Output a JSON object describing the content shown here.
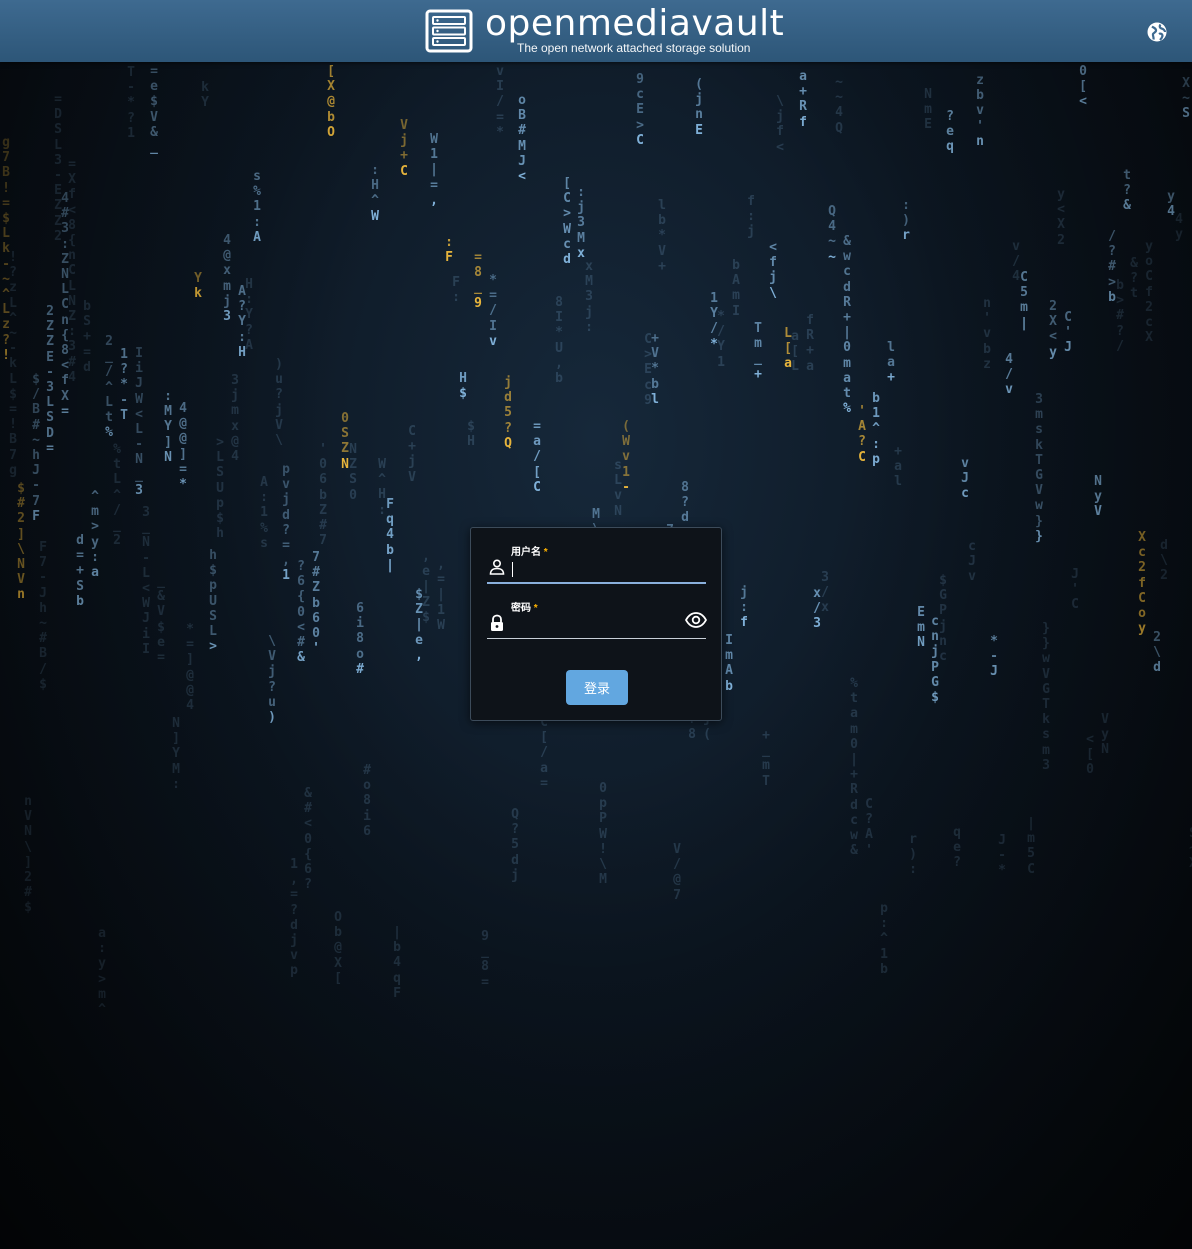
{
  "header": {
    "title": "openmediavault",
    "subtitle": "The open network attached storage solution",
    "logo_icon": "server-icon",
    "language_icon": "globe-icon"
  },
  "login": {
    "username": {
      "label": "用户名",
      "required_mark": "*",
      "value": "",
      "icon": "user-icon"
    },
    "password": {
      "label": "密码",
      "required_mark": "*",
      "value": "",
      "icon": "lock-icon",
      "toggle_icon": "eye-icon"
    },
    "submit_label": "登录"
  },
  "colors": {
    "header_bg": "#3e6a90",
    "button_bg": "#62a7e0",
    "required": "#ffb300",
    "matrix_blue": "#7fb0d8",
    "matrix_gold": "#e6b43c"
  },
  "matrix": {
    "columns": [
      "g7B!=$Lk-~^Lz?!",
      "$#2]\\NVn",
      "$/B#~hJ-7F",
      "2ZZE-3LSD=",
      "4#3:ZNLCn{8<fX=",
      "d=+Sb",
      "^m>y:a",
      "2_/^Lt%",
      "1?*-T",
      "IiJW<L-N_3",
      "=e$V&_",
      ":MY]N",
      "4@@]=*",
      "Yk",
      "h$pUSL>",
      "4@xmj3",
      "A?Y:H",
      "s%1:A",
      "\\Vj?u)",
      "pvjd?=,1",
      "?6{0<#&",
      "7#Zb60'",
      "[X@bO",
      "0SZN",
      "6i8o#",
      ":H^W",
      "Fq4b|",
      "Vj+C",
      "$Z|e,",
      "W1|=,",
      ":F",
      "H$",
      "=8_9",
      "*=/Iv",
      "jd5?Q",
      "oB#MJ<",
      "=a/[C",
      "b,U*I8",
      "[C>Wcd",
      ":j3Mx",
      "M\\!WPp0",
      "NvLs",
      "(Wv1-",
      "9cE>C",
      "+V*bl",
      "7@/V",
      "8?d:m",
      "(jnE",
      "1Y/*",
      "ImAb",
      "j:f",
      "Tm_+",
      "<fj\\",
      "L[a",
      "a+Rf",
      "x/3",
      "Q4~~",
      "&wcdR+|0mat%",
      "'A?C",
      "b1^:p",
      "la+",
      ":)r",
      "EmN",
      "cnjPG$",
      "?eq",
      "vJc",
      "zbv'n",
      "*-J",
      "4/v",
      "C5m|",
      "3mskTGVw}}",
      "2X<y",
      "C'J",
      "0[<",
      "NyV",
      "/?#>b",
      "t?&",
      "Xc2fCoy",
      "2\\d",
      "y4",
      "X~S"
    ],
    "highlight_chars": "$*&"
  }
}
